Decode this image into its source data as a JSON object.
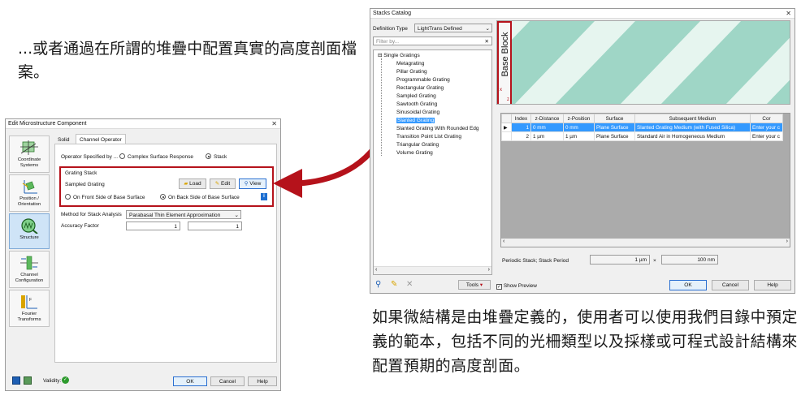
{
  "captions": {
    "top": "...或者通過在所謂的堆疊中配置真實的高度剖面檔案。",
    "bottom": "如果微結構是由堆疊定義的，使用者可以使用我們目錄中預定義的範本，包括不同的光柵類型以及採樣或可程式設計結構來配置預期的高度剖面。"
  },
  "colors": {
    "arrow": "#b5121b",
    "highlight_box": "#b5121b",
    "stripe_light": "#dff2ec",
    "stripe_dark": "#9fd6c6",
    "selection": "#3399ff"
  },
  "edit_dialog": {
    "title": "Edit Microstructure Component",
    "sidebar": [
      {
        "label": "Coordinate Systems",
        "icon": "coordinate-systems-icon"
      },
      {
        "label": "Position / Orientation",
        "icon": "position-orientation-icon"
      },
      {
        "label": "Structure",
        "icon": "structure-icon",
        "active": true
      },
      {
        "label": "Channel Configuration",
        "icon": "channel-configuration-icon"
      },
      {
        "label": "Fourier Transforms",
        "icon": "fourier-transforms-icon"
      }
    ],
    "tabs": [
      "Solid",
      "Channel Operator"
    ],
    "operator_label": "Operator Specified by ...",
    "operator_options": [
      "Complex Surface Response",
      "Stack"
    ],
    "grating_stack_title": "Grating Stack",
    "stack_name": "Sampled Grating",
    "buttons": {
      "load": "Load",
      "edit": "Edit",
      "view": "View",
      "ok": "OK",
      "cancel": "Cancel",
      "help": "Help"
    },
    "side_options": [
      "On Front Side of Base Surface",
      "On Back Side of Base Surface"
    ],
    "method_label": "Method for Stack Analysis",
    "method_value": "Parabasal Thin Element Approximation",
    "accuracy_label": "Accuracy Factor",
    "accuracy_values": [
      "1",
      "1"
    ],
    "validity_label": "Validity:"
  },
  "catalog": {
    "title": "Stacks Catalog",
    "definition_type_label": "Definition Type",
    "definition_type_value": "LightTrans Defined",
    "filter_placeholder": "Filter by...",
    "tree_root": "Single Gratings",
    "tree_items": [
      "Metagrating",
      "Pillar Grating",
      "Programmable Grating",
      "Rectangular Grating",
      "Sampled Grating",
      "Sawtooth Grating",
      "Sinusoidal Grating",
      "Slanted Grating",
      "Slanted Grating With Rounded Edg",
      "Transition Point List Grating",
      "Triangular Grating",
      "Volume Grating"
    ],
    "selected_item": "Slanted Grating",
    "base_block_label": "Base Block",
    "axis_x": "x",
    "axis_z": "z",
    "table": {
      "headers": [
        "Index",
        "z-Distance",
        "z-Position",
        "Surface",
        "Subsequent Medium",
        "Cor"
      ],
      "rows": [
        [
          "1",
          "0 mm",
          "0 mm",
          "Plane Surface",
          "Slanted Grating Medium (with Fused Silica)",
          "Enter your c"
        ],
        [
          "2",
          "1 µm",
          "1 µm",
          "Plane Surface",
          "Standard Air in Homogeneous Medium",
          "Enter your c"
        ]
      ]
    },
    "periodic_label": "Periodic Stack; Stack Period",
    "period_x": "1 µm",
    "times": "×",
    "period_y": "100 nm",
    "tools_label": "Tools",
    "show_preview_label": "Show Preview",
    "buttons": {
      "ok": "OK",
      "cancel": "Cancel",
      "help": "Help"
    }
  }
}
